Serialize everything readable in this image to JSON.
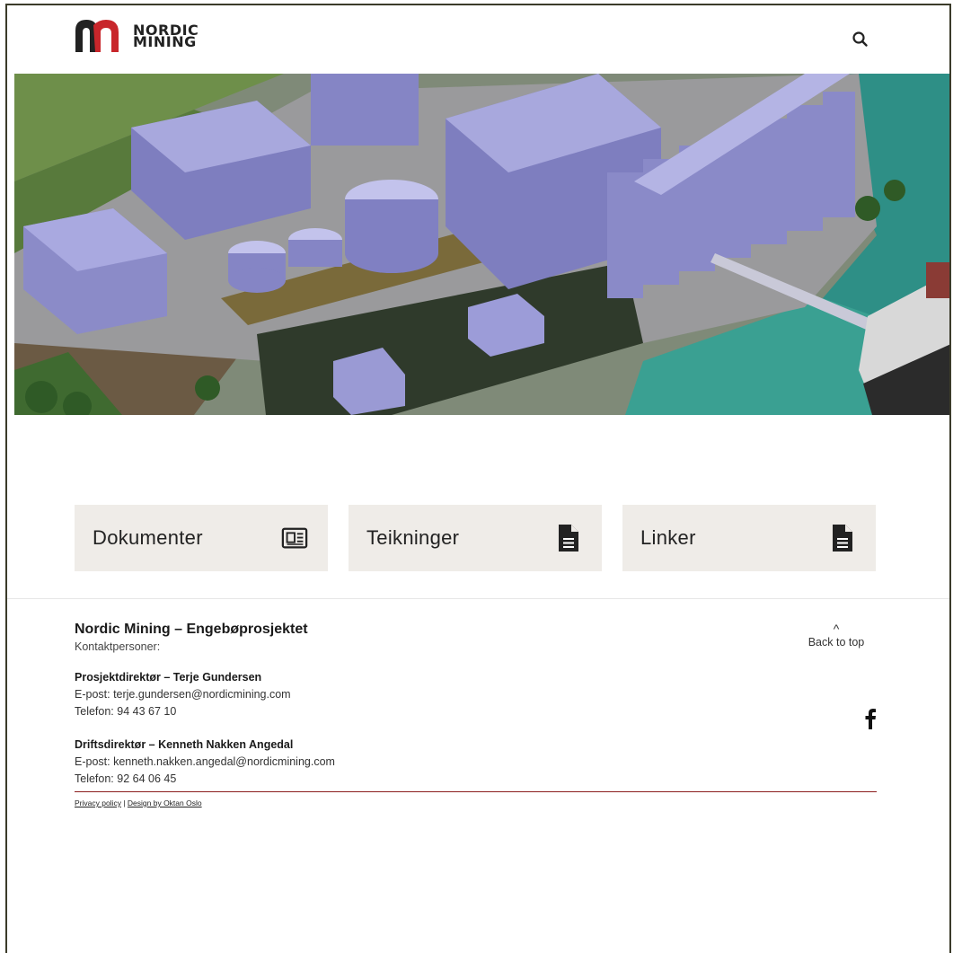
{
  "header": {
    "logo_line1": "NORDIC",
    "logo_line2": "MINING",
    "search_icon": "search-icon"
  },
  "tiles": [
    {
      "label": "Dokumenter",
      "icon": "newspaper-icon"
    },
    {
      "label": "Teikninger",
      "icon": "document-icon"
    },
    {
      "label": "Linker",
      "icon": "document-icon"
    }
  ],
  "footer": {
    "title": "Nordic Mining – Engebøprosjektet",
    "subtitle": "Kontaktpersoner:",
    "contacts": [
      {
        "head": "Prosjektdirektør – Terje Gundersen",
        "email": "E-post: terje.gundersen@nordicmining.com",
        "phone": "Telefon: 94 43 67 10"
      },
      {
        "head": "Driftsdirektør – Kenneth Nakken Angedal",
        "email": "E-post: kenneth.nakken.angedal@nordicmining.com",
        "phone": "Telefon: 92 64 06 45"
      }
    ],
    "back_to_top": "Back to top",
    "caret": "^",
    "facebook_icon": "facebook-icon",
    "privacy": "Privacy policy",
    "separator": " | ",
    "design": "Design by Oktan Oslo"
  },
  "colors": {
    "logo_red": "#c8262b",
    "logo_dark": "#222222",
    "tile_bg": "#efece8",
    "footer_rule": "#8b1d1d"
  }
}
